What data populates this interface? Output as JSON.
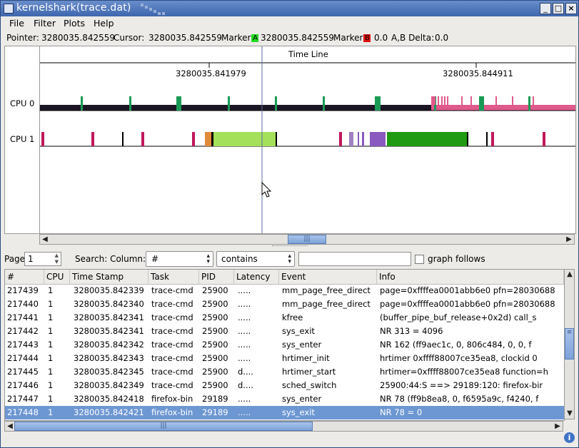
{
  "window": {
    "title": "kernelshark(trace.dat)"
  },
  "menu": [
    "File",
    "Filter",
    "Plots",
    "Help"
  ],
  "pointer_bar": {
    "pointer_label": "Pointer:",
    "pointer_value": "3280035.842559",
    "cursor_label": "Cursor:",
    "cursor_value": "3280035.842559",
    "marker_a_label": "Marker",
    "marker_a_letter": "A",
    "marker_a_value": "3280035.842559",
    "marker_b_label": "Marker",
    "marker_b_letter": "B",
    "marker_b_value": "0.0",
    "delta_label": "A,B Delta:",
    "delta_value": "0.0"
  },
  "colors": {
    "accent": "#6d97d2",
    "marker_a": "#22dd22",
    "marker_b": "#e01010"
  },
  "graph": {
    "timeline_title": "Time Line",
    "tick_labels": [
      "3280035.841979",
      "3280035.844911"
    ],
    "cpus": [
      "CPU 0",
      "CPU 1"
    ]
  },
  "search": {
    "page_label": "Page",
    "page_value": "1",
    "search_label": "Search: Column:",
    "column_value": "#",
    "compare_value": "contains",
    "search_text": "",
    "graph_follows_label": "graph follows"
  },
  "table": {
    "columns": [
      "#",
      "CPU",
      "Time Stamp",
      "Task",
      "PID",
      "Latency",
      "Event",
      "Info"
    ],
    "rows": [
      [
        "217439",
        "1",
        "3280035.842339",
        "trace-cmd",
        "25900",
        ".....",
        "mm_page_free_direct",
        "page=0xffffea0001abb6e0 pfn=28030688"
      ],
      [
        "217440",
        "1",
        "3280035.842340",
        "trace-cmd",
        "25900",
        ".....",
        "mm_page_free_direct",
        "page=0xffffea0001abb6e0 pfn=28030688"
      ],
      [
        "217441",
        "1",
        "3280035.842341",
        "trace-cmd",
        "25900",
        ".....",
        "kfree",
        "(buffer_pipe_buf_release+0x2d) call_s"
      ],
      [
        "217442",
        "1",
        "3280035.842341",
        "trace-cmd",
        "25900",
        ".....",
        "sys_exit",
        "NR 313 = 4096"
      ],
      [
        "217443",
        "1",
        "3280035.842342",
        "trace-cmd",
        "25900",
        ".....",
        "sys_enter",
        "NR 162 (ff9aec1c, 0, 806c484, 0, 0, f"
      ],
      [
        "217444",
        "1",
        "3280035.842343",
        "trace-cmd",
        "25900",
        ".....",
        "hrtimer_init",
        "hrtimer 0xffff88007ce35ea8, clockid 0"
      ],
      [
        "217445",
        "1",
        "3280035.842345",
        "trace-cmd",
        "25900",
        "d....",
        "hrtimer_start",
        "hrtimer=0xffff88007ce35ea8 function=h"
      ],
      [
        "217446",
        "1",
        "3280035.842349",
        "trace-cmd",
        "25900",
        "d....",
        "sched_switch",
        "25900:44:S ==> 29189:120: firefox-bir"
      ],
      [
        "217447",
        "1",
        "3280035.842418",
        "firefox-bin",
        "29189",
        ".....",
        "sys_enter",
        "NR 78 (ff9b8ea8, 0, f6595a9c, f4240, f"
      ],
      [
        "217448",
        "1",
        "3280035.842421",
        "firefox-bin",
        "29189",
        ".....",
        "sys_exit",
        "NR 78 = 0"
      ]
    ],
    "selected_row": 9
  }
}
